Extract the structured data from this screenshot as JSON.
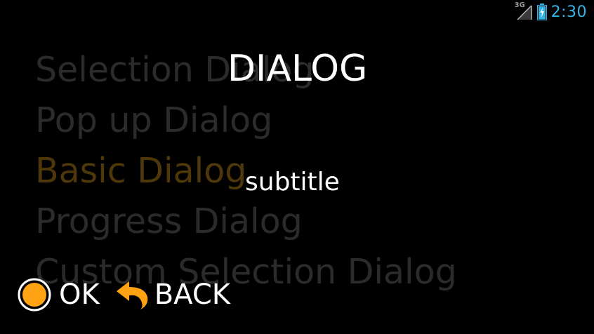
{
  "status_bar": {
    "network_type": "3G",
    "time": "2:30"
  },
  "background_list": {
    "items": [
      {
        "label": "Selection Dialog"
      },
      {
        "label": "Pop up Dialog"
      },
      {
        "label": "Basic Dialog"
      },
      {
        "label": "Progress Dialog"
      },
      {
        "label": "Custom Selection Dialog"
      }
    ],
    "selected_index": 2
  },
  "dialog": {
    "title": "DIALOG",
    "subtitle": "subtitle",
    "ok_label": "OK",
    "back_label": "BACK"
  },
  "colors": {
    "background": "#000000",
    "accent_orange": "#ffa313",
    "clock_blue": "#33b5e5",
    "dim_text": "#2b2b2b",
    "dim_selected_text": "#4e3708",
    "dialog_text": "#ffffff"
  },
  "icons": {
    "ok": "radio-ok-icon",
    "back": "back-arrow-icon",
    "signal": "signal-icon",
    "battery": "battery-charging-icon"
  }
}
